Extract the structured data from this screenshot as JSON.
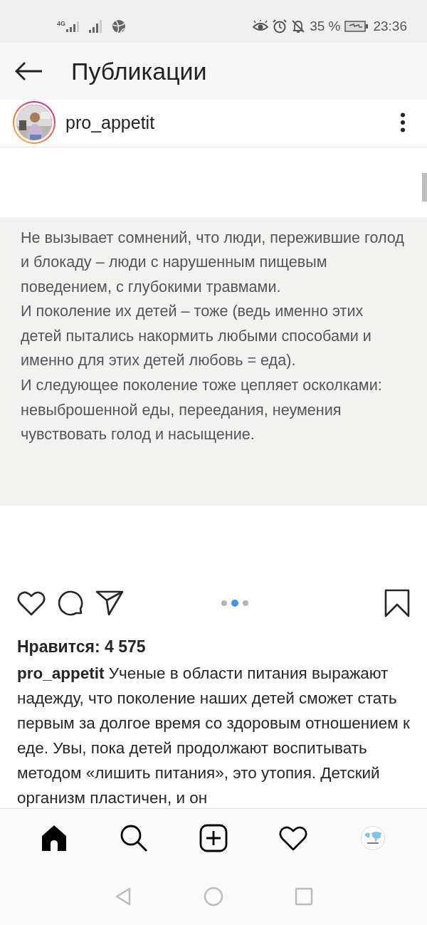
{
  "status_bar": {
    "network": "4G",
    "battery": "35 %",
    "time": "23:36"
  },
  "header": {
    "title": "Публикации"
  },
  "post": {
    "username": "pro_appetit",
    "image_text": [
      "Не вызывает сомнений, что люди, пережившие голод и блокаду – люди с нарушенным пищевым поведением, с глубокими травмами.",
      "И поколение их детей – тоже (ведь именно этих детей пытались накормить любыми способами и именно для этих детей любовь = еда).",
      "И следующее поколение тоже цепляет осколками: невыброшенной еды, переедания, неумения чувствовать голод и насыщение."
    ],
    "dots": [
      {
        "selected": false
      },
      {
        "selected": true
      },
      {
        "selected": false
      }
    ],
    "likes": "Нравится: 4 575",
    "caption": "**pro_appetit** Ученые в области питания выражают надежду, что поколение наших детей сможет стать первым за долгое время со здоровым отношением к еде. Увы, пока детей продолжают воспитывать методом «лишить питания», это утопия. Детский организм пластичен, и он"
  },
  "bottom_nav": [
    {
      "kind": "home",
      "selected": true
    },
    {
      "kind": "search",
      "selected": false
    },
    {
      "kind": "add",
      "selected": false
    },
    {
      "kind": "heart",
      "selected": false
    },
    {
      "kind": "profile",
      "selected": false
    }
  ]
}
